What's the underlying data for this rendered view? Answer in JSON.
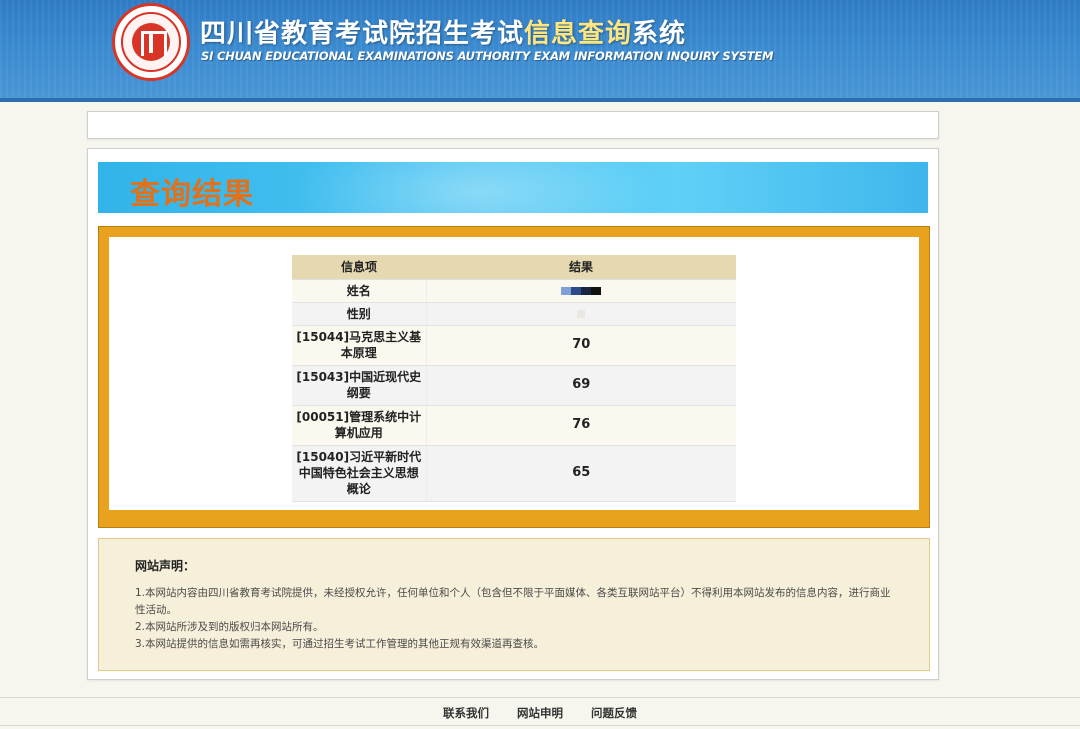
{
  "header": {
    "title_main": "四川省教育考试院招生考试",
    "title_highlight": "信息查询",
    "title_tail": "系统",
    "subtitle": "SI CHUAN EDUCATIONAL EXAMINATIONS AUTHORITY EXAM INFORMATION INQUIRY SYSTEM"
  },
  "result": {
    "banner_title": "查询结果",
    "columns": [
      "信息项",
      "结果"
    ],
    "name_label": "姓名",
    "gender_label": "性别",
    "scores": [
      {
        "item": "[15044]马克思主义基本原理",
        "value": "70"
      },
      {
        "item": "[15043]中国近现代史纲要",
        "value": "69"
      },
      {
        "item": "[00051]管理系统中计算机应用",
        "value": "76"
      },
      {
        "item": "[15040]习近平新时代中国特色社会主义思想概论",
        "value": "65"
      }
    ]
  },
  "declaration": {
    "title": "网站声明：",
    "lines": [
      "1.本网站内容由四川省教育考试院提供，未经授权允许，任何单位和个人（包含但不限于平面媒体、各类互联网站平台）不得利用本网站发布的信息内容，进行商业性活动。",
      "2.本网站所涉及到的版权归本网站所有。",
      "3.本网站提供的信息如需再核实，可通过招生考试工作管理的其他正规有效渠道再查核。"
    ]
  },
  "footer": {
    "contact": "联系我们",
    "statement": "网站申明",
    "feedback": "问题反馈"
  },
  "colors": {
    "header_blue": "#3a8ad0",
    "banner_blue": "#49c3f2",
    "banner_title_orange": "#e1711a",
    "gold_frame": "#e8a21d",
    "table_header": "#e6d9b2",
    "declaration_bg": "#f6efd9",
    "logo_red": "#d83526"
  },
  "icons": [
    "emblem-logo-icon"
  ]
}
